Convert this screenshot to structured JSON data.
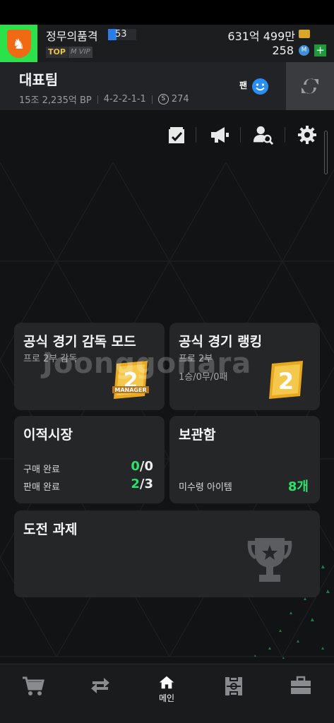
{
  "header": {
    "nickname": "정무의품격",
    "level": "53",
    "tag_top": "TOP",
    "tag_vip": "M VIP",
    "money": "631억 499만",
    "coins": "258",
    "plus": "+"
  },
  "team": {
    "name": "대표팀",
    "bp": "15조 2,235억 BP",
    "formation": "4-2-2-1-1",
    "salary": "274",
    "salary_symbol": "S",
    "fan_label": "팬"
  },
  "cards": {
    "manager_mode": {
      "title": "공식 경기 감독 모드",
      "subtitle": "프로 2부 감독",
      "badge_number": "2",
      "badge_text": "MANAGER"
    },
    "ranking": {
      "title": "공식 경기 랭킹",
      "subtitle": "프로 2부",
      "record": "1승/0무/0패",
      "badge_number": "2"
    },
    "transfer": {
      "title": "이적시장",
      "buy_label": "구매 완료",
      "buy_done": "0",
      "buy_total": "/0",
      "sell_label": "판매 완료",
      "sell_done": "2",
      "sell_total": "/3"
    },
    "storage": {
      "title": "보관함",
      "unclaimed_label": "미수령 아이템",
      "unclaimed_count": "8개"
    },
    "challenges": {
      "title": "도전 과제"
    }
  },
  "watermark": "Joonggonara",
  "nav": {
    "home_label": "메인"
  },
  "colors": {
    "accent_green": "#2be26c",
    "club_bg": "#2be24a",
    "badge_orange": "#f06a14",
    "coin_blue": "#3f8fd8"
  }
}
